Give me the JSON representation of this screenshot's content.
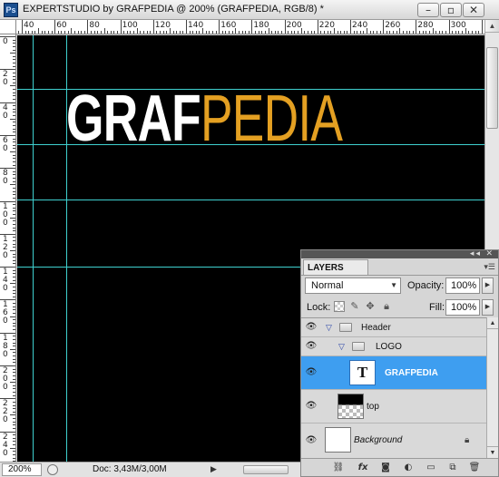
{
  "window": {
    "app_icon": "Ps",
    "title": "EXPERTSTUDIO by GRAFPEDIA @ 200% (GRAFPEDIA, RGB/8) *",
    "controls": {
      "minimize": "minimize-icon",
      "maximize": "maximize-icon",
      "close": "close-icon"
    }
  },
  "rulers": {
    "horizontal": [
      "40",
      "60",
      "80",
      "100",
      "120",
      "140",
      "160",
      "180",
      "200",
      "220",
      "240",
      "260",
      "280",
      "300"
    ],
    "vertical": [
      "0",
      "2\n0",
      "4\n0",
      "6\n0",
      "8\n0",
      "1\n0\n0",
      "1\n2\n0",
      "1\n4\n0",
      "1\n6\n0",
      "1\n8\n0",
      "2\n0\n0",
      "2\n2\n0",
      "2\n4\n0"
    ]
  },
  "canvas": {
    "logo_white": "GRAF",
    "logo_orange": "PEDIA",
    "colors": {
      "background": "#000000",
      "white_text": "#ffffff",
      "orange_text": "#e4a022",
      "guides": "#3fd0cf"
    }
  },
  "status": {
    "zoom": "200%",
    "doc_info": "Doc: 3,43M/3,00M",
    "arrow": "▶"
  },
  "layers_panel": {
    "tab": "LAYERS",
    "blend_mode": "Normal",
    "opacity_label": "Opacity:",
    "opacity_value": "100%",
    "lock_label": "Lock:",
    "fill_label": "Fill:",
    "fill_value": "100%",
    "layers": [
      {
        "name": "Header",
        "type": "group",
        "visible": true,
        "expanded": true
      },
      {
        "name": "LOGO",
        "type": "group",
        "visible": true,
        "expanded": true
      },
      {
        "name": "GRAFPEDIA",
        "type": "text",
        "visible": true,
        "selected": true
      },
      {
        "name": "top",
        "type": "pixel",
        "visible": true
      },
      {
        "name": "Background",
        "type": "background",
        "visible": true,
        "locked": true
      }
    ],
    "selected_color": "#3e9ef0",
    "bottom_buttons": [
      "link-icon",
      "fx-icon",
      "mask-icon",
      "adjustment-icon",
      "new-group-icon",
      "new-layer-icon",
      "trash-icon"
    ]
  }
}
